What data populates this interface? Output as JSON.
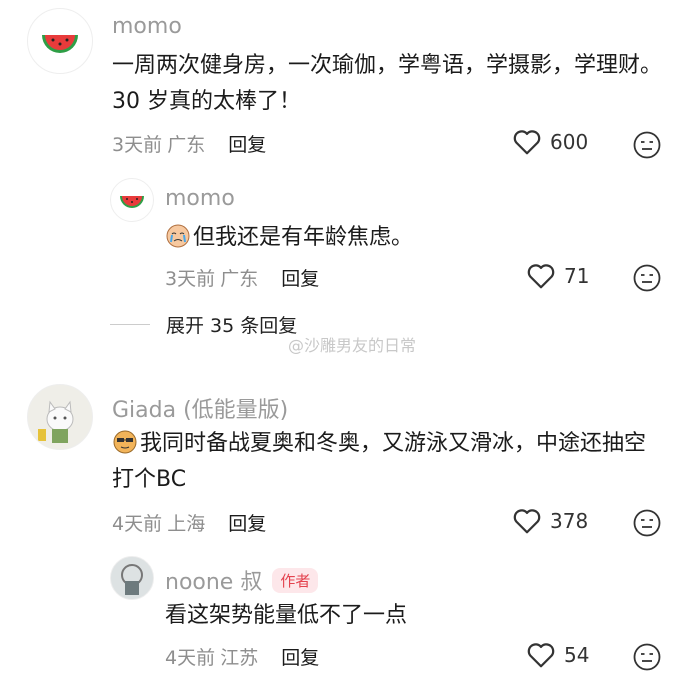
{
  "comments": [
    {
      "username": "momo",
      "text": "一周两次健身房，一次瑜伽，学粤语，学摄影，学理财。30 岁真的太棒了！",
      "time": "3天前",
      "location": "广东",
      "reply_label": "回复",
      "likes": "600",
      "replies": [
        {
          "username": "momo",
          "text": "但我还是有年龄焦虑。",
          "time": "3天前",
          "location": "广东",
          "reply_label": "回复",
          "likes": "71"
        }
      ],
      "expand_label": "展开 35 条回复"
    },
    {
      "username": "Giada (低能量版)",
      "text": "我同时备战夏奥和冬奥，又游泳又滑冰，中途还抽空打个BC",
      "time": "4天前",
      "location": "上海",
      "reply_label": "回复",
      "likes": "378",
      "replies": [
        {
          "username": "noone 叔",
          "author_tag": "作者",
          "text": "看这架势能量低不了一点",
          "time": "4天前",
          "location": "江苏",
          "reply_label": "回复",
          "likes": "54"
        }
      ]
    }
  ],
  "watermark": "@沙雕男友的日常"
}
